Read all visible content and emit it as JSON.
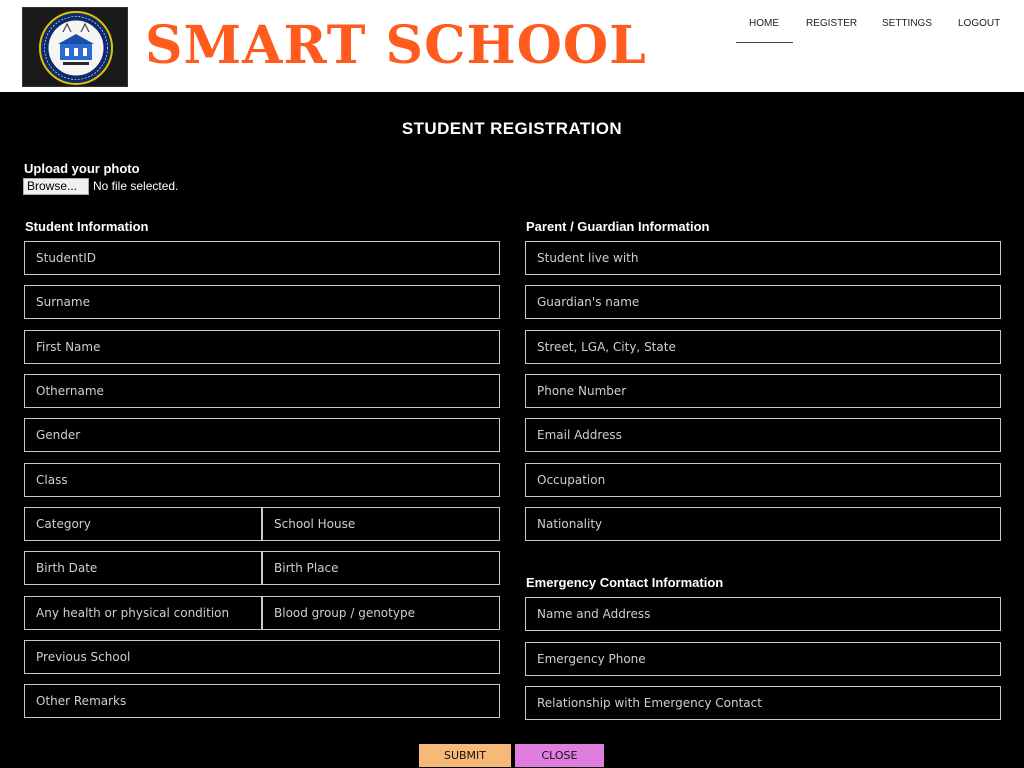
{
  "header": {
    "brand": "SMART SCHOOL",
    "nav": [
      {
        "label": "HOME"
      },
      {
        "label": "REGISTER"
      },
      {
        "label": "SETTINGS"
      },
      {
        "label": "LOGOUT"
      }
    ]
  },
  "page": {
    "title": "STUDENT REGISTRATION"
  },
  "upload": {
    "label": "Upload your photo",
    "button": "Browse...",
    "status": "No file selected."
  },
  "student": {
    "title": "Student Information",
    "fields": {
      "student_id": "StudentID",
      "surname": "Surname",
      "first_name": "First Name",
      "othername": "Othername",
      "gender": "Gender",
      "class": "Class",
      "category": "Category",
      "school_house": "School House",
      "birth_date": "Birth Date",
      "birth_place": "Birth Place",
      "health": "Any health or physical condition",
      "blood_group": "Blood group / genotype",
      "previous_school": "Previous School",
      "other_remarks": "Other Remarks"
    }
  },
  "guardian": {
    "title": "Parent / Guardian Information",
    "fields": {
      "lives_with": "Student live with",
      "guardian_name": "Guardian's name",
      "address": "Street, LGA, City, State",
      "phone": "Phone Number",
      "email": "Email Address",
      "occupation": "Occupation",
      "nationality": "Nationality"
    }
  },
  "emergency": {
    "title": "Emergency Contact Information",
    "fields": {
      "name_address": "Name and Address",
      "phone": "Emergency Phone",
      "relationship": "Relationship with Emergency Contact"
    }
  },
  "actions": {
    "submit": "SUBMIT",
    "close": "CLOSE"
  },
  "colors": {
    "brand": "#ff5b1f",
    "submit": "#f8b878",
    "close": "#e07ee0",
    "background": "#000000"
  }
}
